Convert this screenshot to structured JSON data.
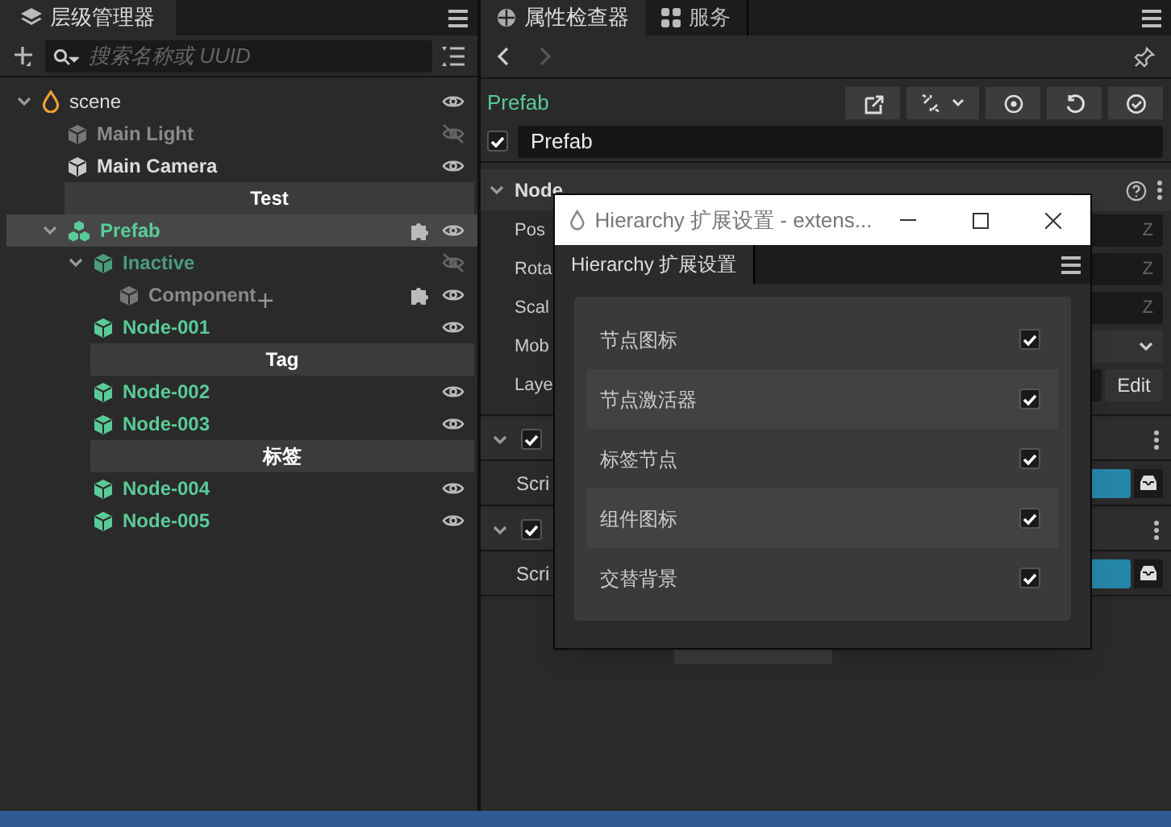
{
  "hierarchy": {
    "tab": {
      "title": "层级管理器",
      "selected": true
    },
    "search": {
      "placeholder": "搜索名称或 UUID"
    },
    "tree": [
      {
        "kind": "scene",
        "label": "scene",
        "selected": false,
        "active": true,
        "expanded": true,
        "visible": true,
        "children": [
          {
            "kind": "node",
            "label": "Main Light",
            "selected": false,
            "active": false,
            "visible": false
          },
          {
            "kind": "node",
            "label": "Main Camera",
            "selected": false,
            "active": true,
            "visible": true
          },
          {
            "kind": "header",
            "label": "Test"
          },
          {
            "kind": "prefab",
            "label": "Prefab",
            "selected": true,
            "active": true,
            "expanded": true,
            "visible": true,
            "has_component": true,
            "children": [
              {
                "kind": "prefab-node",
                "label": "Inactive",
                "selected": false,
                "active": false,
                "expanded": true,
                "visible": false,
                "children": [
                  {
                    "kind": "node",
                    "label": "Component",
                    "selected": false,
                    "active": false,
                    "visible": true,
                    "has_component": true,
                    "added": true
                  }
                ]
              },
              {
                "kind": "prefab-node",
                "label": "Node-001",
                "selected": false,
                "active": true,
                "visible": true
              },
              {
                "kind": "header",
                "label": "Tag"
              },
              {
                "kind": "prefab-node",
                "label": "Node-002",
                "selected": false,
                "active": true,
                "visible": true
              },
              {
                "kind": "prefab-node",
                "label": "Node-003",
                "selected": false,
                "active": true,
                "visible": true
              },
              {
                "kind": "header",
                "label": "标签"
              },
              {
                "kind": "prefab-node",
                "label": "Node-004",
                "selected": false,
                "active": true,
                "visible": true
              },
              {
                "kind": "prefab-node",
                "label": "Node-005",
                "selected": false,
                "active": true,
                "visible": true
              }
            ]
          }
        ]
      }
    ]
  },
  "inspector": {
    "tabs": [
      {
        "label": "属性检查器",
        "selected": true
      },
      {
        "label": "服务",
        "selected": false
      }
    ],
    "asset_label": "Prefab",
    "node": {
      "active": true,
      "name": "Prefab"
    },
    "node_section": {
      "title": "Node",
      "expanded": true,
      "properties": [
        {
          "kind": "vector",
          "label": "Pos",
          "axis": "Z"
        },
        {
          "kind": "vector",
          "label": "Rota",
          "axis": "Z"
        },
        {
          "kind": "vector",
          "label": "Scal",
          "axis": "Z"
        },
        {
          "kind": "select",
          "label": "Mob"
        },
        {
          "kind": "layer",
          "label": "Laye",
          "button": "Edit"
        }
      ]
    },
    "components": [
      {
        "expanded": true,
        "enabled": true,
        "property": "Scri"
      },
      {
        "expanded": true,
        "enabled": true,
        "property": "Scri"
      }
    ]
  },
  "dialog": {
    "title": "Hierarchy 扩展设置 - extens...",
    "tab": "Hierarchy 扩展设置",
    "settings": [
      {
        "label": "节点图标",
        "checked": true
      },
      {
        "label": "节点激活器",
        "checked": true
      },
      {
        "label": "标签节点",
        "checked": true
      },
      {
        "label": "组件图标",
        "checked": true
      },
      {
        "label": "交替背景",
        "checked": true
      }
    ]
  }
}
